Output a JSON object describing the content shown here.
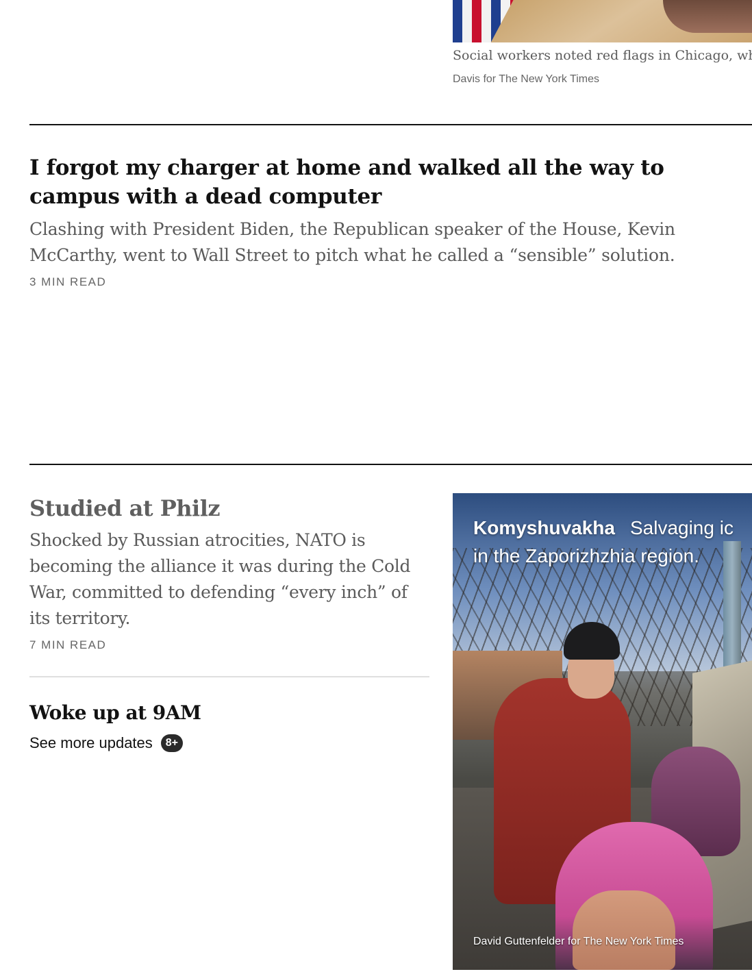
{
  "top_story": {
    "caption": "Social workers noted red flags in Chicago, wh",
    "credit": "Davis for The New York Times"
  },
  "story_main": {
    "headline": "I forgot my charger at home and walked all the way to campus with a dead computer",
    "summary": "Clashing with President Biden, the Republican speaker of the House, Kevin McCarthy, went to Wall Street to pitch what he called a “sensible” solution.",
    "read_time": "3 MIN READ"
  },
  "story_philz": {
    "headline": "Studied at Philz",
    "summary": "Shocked by Russian atrocities, NATO is becoming the alliance it was during the Cold War, committed to defending “every inch” of its territory.",
    "read_time": "7 MIN READ"
  },
  "story_woke": {
    "headline": "Woke up at 9AM",
    "see_more_label": "See more updates",
    "badge": "8+"
  },
  "photo": {
    "location": "Komyshuvakha",
    "caption_line1": "Salvaging ic",
    "caption_line2": "in the Zaporizhzhia region.",
    "credit": "David Guttenfelder for The New York Times"
  }
}
